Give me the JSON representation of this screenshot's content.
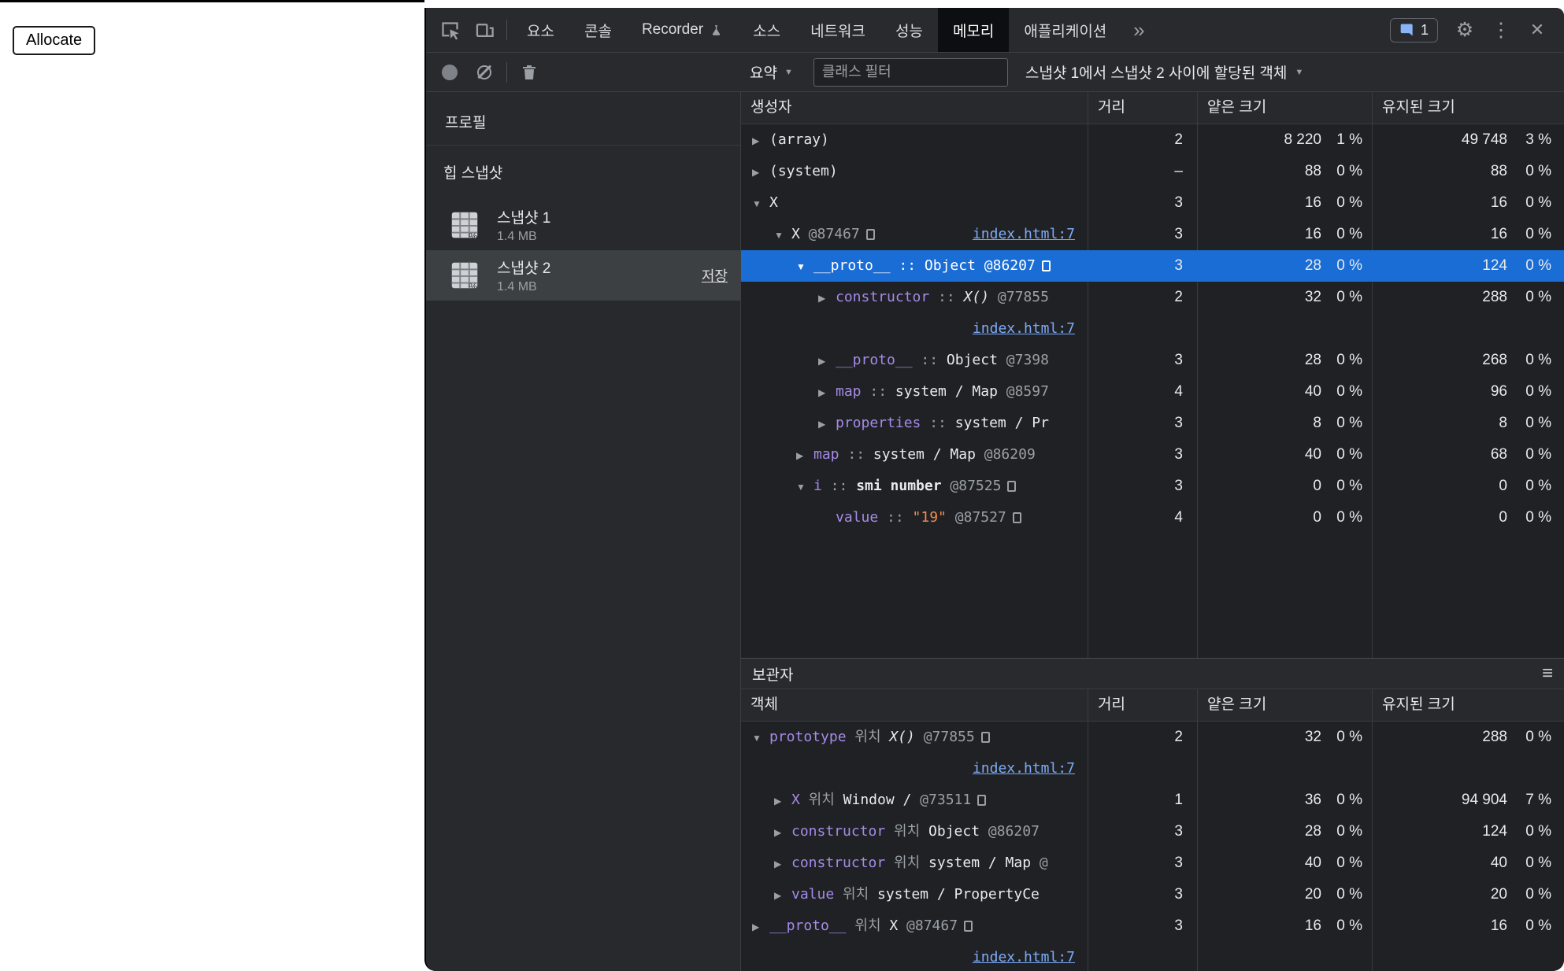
{
  "colors": {
    "text": "#e8eaed",
    "muted": "#9aa0a6",
    "link": "#7cacf8",
    "property": "#a58ae8",
    "string": "#f28b54",
    "selection": "#1a6dd5",
    "panel_bg": "#202124",
    "toolbar_bg": "#292a2d",
    "border": "#3c4043"
  },
  "icons": {
    "collapsed": "▶",
    "expanded": "▼",
    "caret": "▼",
    "hamburger": "≡",
    "chevron": "»",
    "gear": "⚙",
    "kebab": "⋮",
    "close": "✕"
  },
  "page": {
    "allocate_button": "Allocate"
  },
  "tabbar": {
    "tabs": [
      {
        "id": "elements",
        "label": "요소"
      },
      {
        "id": "console",
        "label": "콘솔"
      },
      {
        "id": "recorder",
        "label": "Recorder",
        "experiment": true
      },
      {
        "id": "sources",
        "label": "소스"
      },
      {
        "id": "network",
        "label": "네트워크"
      },
      {
        "id": "performance",
        "label": "성능"
      },
      {
        "id": "memory",
        "label": "메모리",
        "selected": true
      },
      {
        "id": "application",
        "label": "애플리케이션"
      }
    ],
    "issues_count": "1"
  },
  "toolbar": {
    "perspective": "요약",
    "filter_placeholder": "클래스 필터",
    "allocation_filter": "스냅샷 1에서 스냅샷 2 사이에 할당된 객체"
  },
  "sidebar": {
    "title": "프로필",
    "section": "힙 스냅샷",
    "snapshots": [
      {
        "name": "스냅샷 1",
        "size": "1.4 MB",
        "selected": false
      },
      {
        "name": "스냅샷 2",
        "size": "1.4 MB",
        "selected": true,
        "action": "저장"
      }
    ]
  },
  "grid": {
    "columns": [
      "생성자",
      "거리",
      "얕은 크기",
      "유지된 크기"
    ],
    "rows": [
      {
        "ind": 0,
        "a": "c",
        "t": [
          [
            "o",
            "(array)"
          ]
        ],
        "d": "2",
        "s": "8 220",
        "sp": "1 %",
        "r": "49 748",
        "rp": "3 %"
      },
      {
        "ind": 0,
        "a": "c",
        "t": [
          [
            "o",
            "(system)"
          ]
        ],
        "d": "–",
        "s": "88",
        "sp": "0 %",
        "r": "88",
        "rp": "0 %"
      },
      {
        "ind": 0,
        "a": "o",
        "t": [
          [
            "o",
            "X"
          ]
        ],
        "d": "3",
        "s": "16",
        "sp": "0 %",
        "r": "16",
        "rp": "0 %"
      },
      {
        "ind": 1,
        "a": "o",
        "t": [
          [
            "o",
            "X"
          ],
          [
            "m",
            " @87467"
          ],
          [
            "x",
            ""
          ]
        ],
        "rightLink": "index.html:7",
        "d": "3",
        "s": "16",
        "sp": "0 %",
        "r": "16",
        "rp": "0 %"
      },
      {
        "ind": 2,
        "a": "o",
        "sel": true,
        "t": [
          [
            "p",
            "__proto__"
          ],
          [
            "m",
            " :: "
          ],
          [
            "o",
            "Object"
          ],
          [
            "m",
            " @86207"
          ],
          [
            "x",
            ""
          ]
        ],
        "d": "3",
        "s": "28",
        "sp": "0 %",
        "r": "124",
        "rp": "0 %"
      },
      {
        "ind": 3,
        "a": "c",
        "subLink": "index.html:7",
        "t": [
          [
            "p",
            "constructor"
          ],
          [
            "m",
            " :: "
          ],
          [
            "i",
            "X()"
          ],
          [
            "m",
            " @77855"
          ]
        ],
        "d": "2",
        "s": "32",
        "sp": "0 %",
        "r": "288",
        "rp": "0 %"
      },
      {
        "ind": 3,
        "a": "c",
        "t": [
          [
            "p",
            "__proto__"
          ],
          [
            "m",
            " :: "
          ],
          [
            "o",
            "Object"
          ],
          [
            "m",
            " @7398"
          ]
        ],
        "d": "3",
        "s": "28",
        "sp": "0 %",
        "r": "268",
        "rp": "0 %"
      },
      {
        "ind": 3,
        "a": "c",
        "t": [
          [
            "p",
            "map"
          ],
          [
            "m",
            " :: "
          ],
          [
            "o",
            "system / Map"
          ],
          [
            "m",
            " @8597"
          ]
        ],
        "d": "4",
        "s": "40",
        "sp": "0 %",
        "r": "96",
        "rp": "0 %"
      },
      {
        "ind": 3,
        "a": "c",
        "t": [
          [
            "p",
            "properties"
          ],
          [
            "m",
            " :: "
          ],
          [
            "o",
            "system / Pr"
          ]
        ],
        "d": "3",
        "s": "8",
        "sp": "0 %",
        "r": "8",
        "rp": "0 %"
      },
      {
        "ind": 2,
        "a": "c",
        "t": [
          [
            "p",
            "map"
          ],
          [
            "m",
            " :: "
          ],
          [
            "o",
            "system / Map"
          ],
          [
            "m",
            " @86209"
          ]
        ],
        "d": "3",
        "s": "40",
        "sp": "0 %",
        "r": "68",
        "rp": "0 %"
      },
      {
        "ind": 2,
        "a": "o",
        "t": [
          [
            "p",
            "i"
          ],
          [
            "m",
            " :: "
          ],
          [
            "b",
            "smi number"
          ],
          [
            "m",
            " @87525"
          ],
          [
            "x",
            ""
          ]
        ],
        "d": "3",
        "s": "0",
        "sp": "0 %",
        "r": "0",
        "rp": "0 %"
      },
      {
        "ind": 3,
        "a": null,
        "t": [
          [
            "p",
            "value"
          ],
          [
            "m",
            " :: "
          ],
          [
            "s",
            "\"19\""
          ],
          [
            "m",
            " @87527"
          ],
          [
            "x",
            ""
          ]
        ],
        "d": "4",
        "s": "0",
        "sp": "0 %",
        "r": "0",
        "rp": "0 %"
      }
    ]
  },
  "retainers": {
    "title": "보관자",
    "columns": [
      "객체",
      "거리",
      "얕은 크기",
      "유지된 크기"
    ],
    "rows": [
      {
        "ind": 0,
        "a": "o",
        "subLink": "index.html:7",
        "t": [
          [
            "p",
            "prototype"
          ],
          [
            "m",
            " 위치 "
          ],
          [
            "i",
            "X()"
          ],
          [
            "m",
            " @77855"
          ],
          [
            "x",
            ""
          ]
        ],
        "d": "2",
        "s": "32",
        "sp": "0 %",
        "r": "288",
        "rp": "0 %"
      },
      {
        "ind": 1,
        "a": "c",
        "t": [
          [
            "p",
            "X"
          ],
          [
            "m",
            " 위치 "
          ],
          [
            "o",
            "Window /"
          ],
          [
            "m",
            "  @73511"
          ],
          [
            "x",
            ""
          ]
        ],
        "d": "1",
        "s": "36",
        "sp": "0 %",
        "r": "94 904",
        "rp": "7 %"
      },
      {
        "ind": 1,
        "a": "c",
        "t": [
          [
            "p",
            "constructor"
          ],
          [
            "m",
            " 위치 "
          ],
          [
            "o",
            "Object"
          ],
          [
            "m",
            " @86207"
          ]
        ],
        "d": "3",
        "s": "28",
        "sp": "0 %",
        "r": "124",
        "rp": "0 %"
      },
      {
        "ind": 1,
        "a": "c",
        "t": [
          [
            "p",
            "constructor"
          ],
          [
            "m",
            " 위치 "
          ],
          [
            "o",
            "system / Map"
          ],
          [
            "m",
            " @"
          ]
        ],
        "d": "3",
        "s": "40",
        "sp": "0 %",
        "r": "40",
        "rp": "0 %"
      },
      {
        "ind": 1,
        "a": "c",
        "t": [
          [
            "p",
            "value"
          ],
          [
            "m",
            " 위치 "
          ],
          [
            "o",
            "system / PropertyCe"
          ]
        ],
        "d": "3",
        "s": "20",
        "sp": "0 %",
        "r": "20",
        "rp": "0 %"
      },
      {
        "ind": 0,
        "a": "c",
        "subLink": "index.html:7",
        "t": [
          [
            "p",
            "__proto__"
          ],
          [
            "m",
            " 위치 "
          ],
          [
            "o",
            "X"
          ],
          [
            "m",
            " @87467"
          ],
          [
            "x",
            ""
          ]
        ],
        "d": "3",
        "s": "16",
        "sp": "0 %",
        "r": "16",
        "rp": "0 %"
      }
    ]
  }
}
